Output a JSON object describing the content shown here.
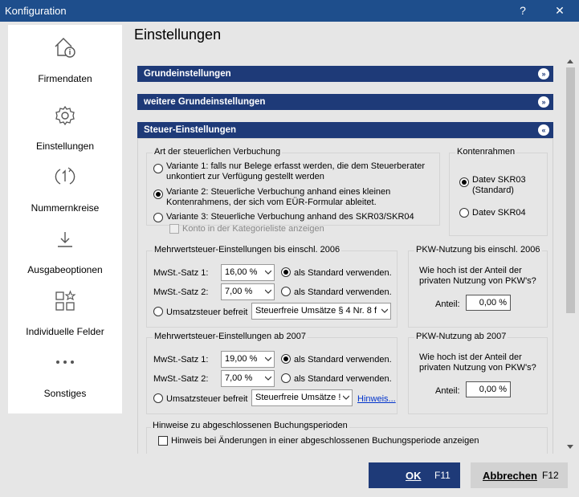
{
  "window": {
    "title": "Konfiguration",
    "help_label": "?",
    "close_label": "✕"
  },
  "sidebar": {
    "items": [
      {
        "label": "Firmendaten",
        "icon": "house-info-icon"
      },
      {
        "label": "Einstellungen",
        "icon": "gear-icon"
      },
      {
        "label": "Nummernkreise",
        "icon": "cycle-one-icon"
      },
      {
        "label": "Ausgabeoptionen",
        "icon": "download-icon"
      },
      {
        "label": "Individuelle Felder",
        "icon": "grid-star-icon"
      },
      {
        "label": "Sonstiges",
        "icon": "more-dots-icon"
      }
    ]
  },
  "main": {
    "title": "Einstellungen",
    "sections": [
      {
        "label": "Grundeinstellungen",
        "chevron": "»",
        "expanded": false
      },
      {
        "label": "weitere Grundeinstellungen",
        "chevron": "»",
        "expanded": false
      },
      {
        "label": "Steuer-Einstellungen",
        "chevron": "«",
        "expanded": true
      }
    ]
  },
  "tax": {
    "verbuchung": {
      "title": "Art der steuerlichen Verbuchung",
      "options": [
        {
          "line1": "Variante 1: falls nur Belege erfasst werden, die dem Steuerberater",
          "line2": "unkontiert zur Verfügung gestellt werden",
          "selected": false
        },
        {
          "line1": "Variante 2: Steuerliche Verbuchung anhand eines kleinen",
          "line2": "Kontenrahmens, der sich vom EÜR-Formular ableitet.",
          "selected": true
        },
        {
          "line1": "Variante 3: Steuerliche Verbuchung anhand des SKR03/SKR04",
          "line2": "",
          "selected": false
        }
      ],
      "checkbox_label": "Konto in der Kategorieliste anzeigen"
    },
    "kontenrahmen": {
      "title": "Kontenrahmen",
      "options": [
        {
          "line1": "Datev SKR03",
          "line2": "(Standard)",
          "selected": true
        },
        {
          "line1": "Datev SKR04",
          "line2": "",
          "selected": false
        }
      ]
    },
    "mwst2006": {
      "title": "Mehrwertsteuer-Einstellungen bis einschl. 2006",
      "rate1_label": "MwSt.-Satz 1:",
      "rate1_value": "16,00 %",
      "rate2_label": "MwSt.-Satz 2:",
      "rate2_value": "7,00 %",
      "standard_label": "als Standard verwenden.",
      "exempt_label": "Umsatzsteuer befreit",
      "exempt_value": "Steuerfreie Umsätze § 4 Nr. 8 f"
    },
    "pkw2006": {
      "title": "PKW-Nutzung bis einschl. 2006",
      "question_line1": "Wie hoch ist der Anteil der",
      "question_line2": "privaten Nutzung von PKW's?",
      "share_label": "Anteil:",
      "share_value": "0,00 %"
    },
    "mwst2007": {
      "title": "Mehrwertsteuer-Einstellungen ab 2007",
      "rate1_label": "MwSt.-Satz 1:",
      "rate1_value": "19,00 %",
      "rate2_label": "MwSt.-Satz 2:",
      "rate2_value": "7,00 %",
      "standard_label": "als Standard verwenden.",
      "exempt_label": "Umsatzsteuer befreit",
      "exempt_value": "Steuerfreie Umsätze !",
      "hint_link": "Hinweis..."
    },
    "pkw2007": {
      "title": "PKW-Nutzung ab 2007",
      "question_line1": "Wie hoch ist der Anteil der",
      "question_line2": "privaten Nutzung von PKW's?",
      "share_label": "Anteil:",
      "share_value": "0,00 %"
    },
    "perioden": {
      "title": "Hinweise zu abgeschlossenen Buchungsperioden",
      "checkbox_label": "Hinweis bei Änderungen in einer abgeschlossenen Buchungsperiode anzeigen"
    }
  },
  "footer": {
    "ok_label": "OK",
    "ok_key": "F11",
    "cancel_label": "Abbrechen",
    "cancel_key": "F12"
  },
  "colors": {
    "titlebar": "#1e4e8c",
    "section_bar": "#1e3a78",
    "accent_button": "#1e3a78"
  }
}
